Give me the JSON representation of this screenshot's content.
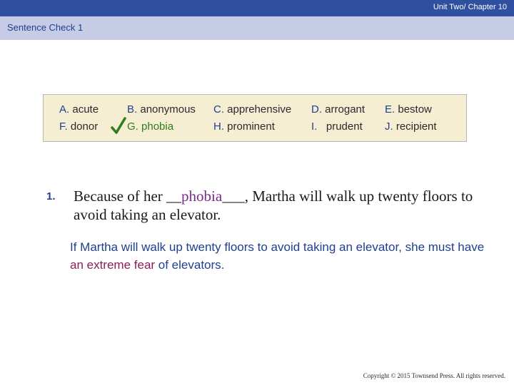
{
  "header": {
    "chapter": "Unit Two/ Chapter 10",
    "section_title": "Sentence Check 1"
  },
  "word_bank": {
    "items": [
      {
        "letter": "A.",
        "word": "acute"
      },
      {
        "letter": "B.",
        "word": "anonymous"
      },
      {
        "letter": "C.",
        "word": "apprehensive"
      },
      {
        "letter": "D.",
        "word": "arrogant"
      },
      {
        "letter": "E.",
        "word": "bestow"
      },
      {
        "letter": "F.",
        "word": "donor"
      },
      {
        "letter": "G.",
        "word": "phobia"
      },
      {
        "letter": "H.",
        "word": "prominent"
      },
      {
        "letter": "I.",
        "word": "prudent"
      },
      {
        "letter": "J.",
        "word": "recipient"
      }
    ],
    "check_icon": "checkmark-icon"
  },
  "question": {
    "number": "1.",
    "before": "Because of her __",
    "answer": "phobia",
    "after": "___, Martha will walk up twenty floors to avoid taking an elevator."
  },
  "explanation": {
    "before": "If Martha will walk up twenty floors to avoid taking an elevator, she must have ",
    "highlight": "an extreme fear",
    "after": " of elevators."
  },
  "footer": {
    "copyright": "Copyright © 2015 Townsend Press. All rights reserved."
  },
  "colors": {
    "top_bar": "#2f4f9f",
    "title_band": "#c6cbe6",
    "word_box": "#f6eed3",
    "accent_blue": "#1f3f8f",
    "answer_purple": "#7a2a8a",
    "highlight_red": "#8a1f5a",
    "check_green": "#2f7d1e"
  }
}
